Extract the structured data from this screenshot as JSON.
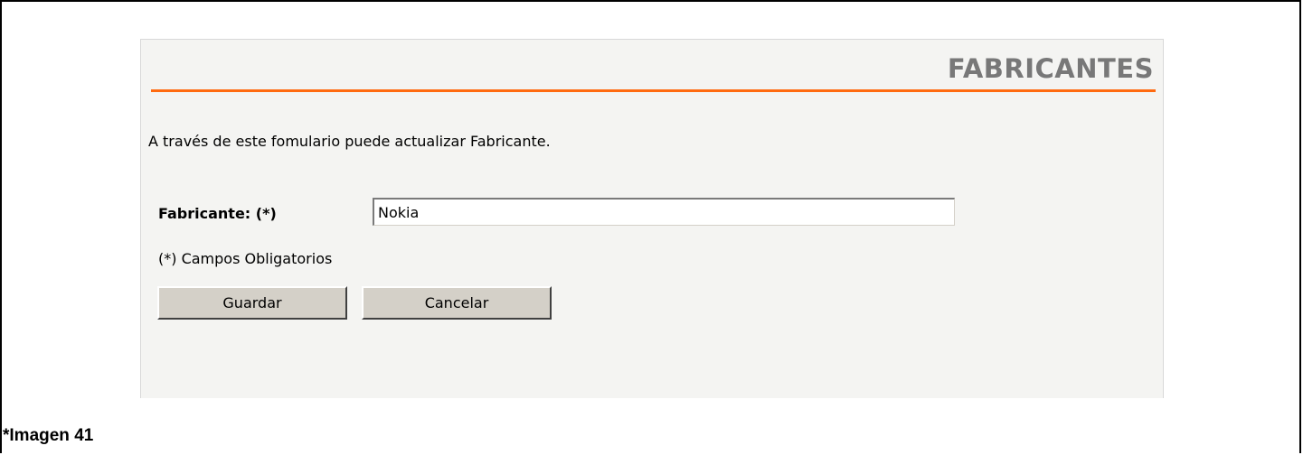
{
  "panel": {
    "title": "FABRICANTES",
    "intro": "A través de este fomulario puede actualizar Fabricante.",
    "accent_color": "#ff6a10"
  },
  "form": {
    "label": "Fabricante: (*)",
    "value": "Nokia",
    "required_note": "(*) Campos Obligatorios"
  },
  "buttons": {
    "save": "Guardar",
    "cancel": "Cancelar"
  },
  "caption": "*Imagen 41"
}
